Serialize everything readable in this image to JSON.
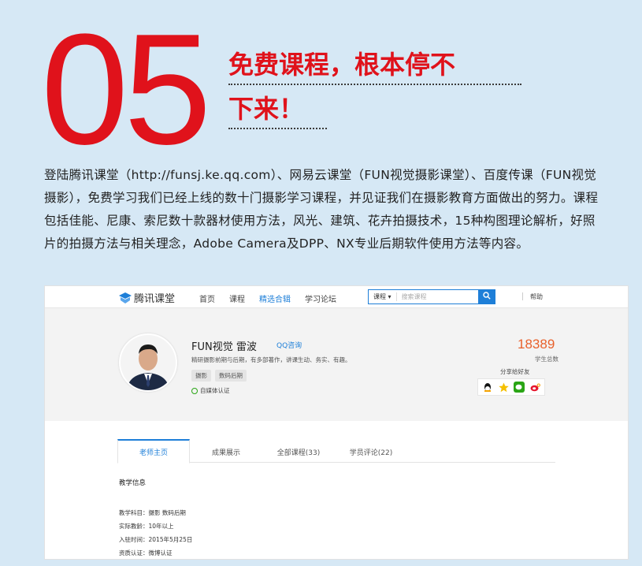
{
  "hero": {
    "number": "05",
    "headline_line1": "免费课程，根本停不",
    "headline_line2": "下来！",
    "intro": "登陆腾讯课堂（http://funsj.ke.qq.com）、网易云课堂（FUN视觉摄影课堂）、百度传课（FUN视觉摄影），免费学习我们已经上线的数十门摄影学习课程，并见证我们在摄影教育方面做出的努力。课程包括佳能、尼康、索尼数十款器材使用方法，风光、建筑、花卉拍摄技术，15种构图理论解析，好照片的拍摄方法与相关理念，Adobe Camera及DPP、NX专业后期软件使用方法等内容。"
  },
  "site": {
    "logo_text": "腾讯课堂",
    "nav": [
      "首页",
      "课程",
      "精选合辑",
      "学习论坛"
    ],
    "nav_active_index": 2,
    "search_category": "课程 ▾",
    "search_placeholder": "搜索课程",
    "help": "帮助"
  },
  "profile": {
    "name": "FUN视觉 雷波",
    "qq_link": "QQ咨询",
    "bio": "精研摄影前期与后期，有多部著作，讲课生动、务实、有趣。",
    "tags": [
      "摄影",
      "数码后期"
    ],
    "verify": "自媒体认证",
    "students_count": "18389",
    "students_label": "学生总数",
    "share_label": "分享给好友"
  },
  "tabs": [
    {
      "label": "老师主页"
    },
    {
      "label": "成果展示"
    },
    {
      "label": "全部课程(33)"
    },
    {
      "label": "学员评论(22)"
    }
  ],
  "teaching": {
    "title": "教学信息",
    "subject": "教学科目：摄影  数码后期",
    "years": "实际教龄：10年以上",
    "joined": "入驻时间：2015年5月25日",
    "credential": "资质认证：微博认证"
  },
  "colors": {
    "accent_red": "#e0121b",
    "link_blue": "#1e7fd8",
    "count_orange": "#e8612c",
    "background": "#d6e8f5"
  }
}
